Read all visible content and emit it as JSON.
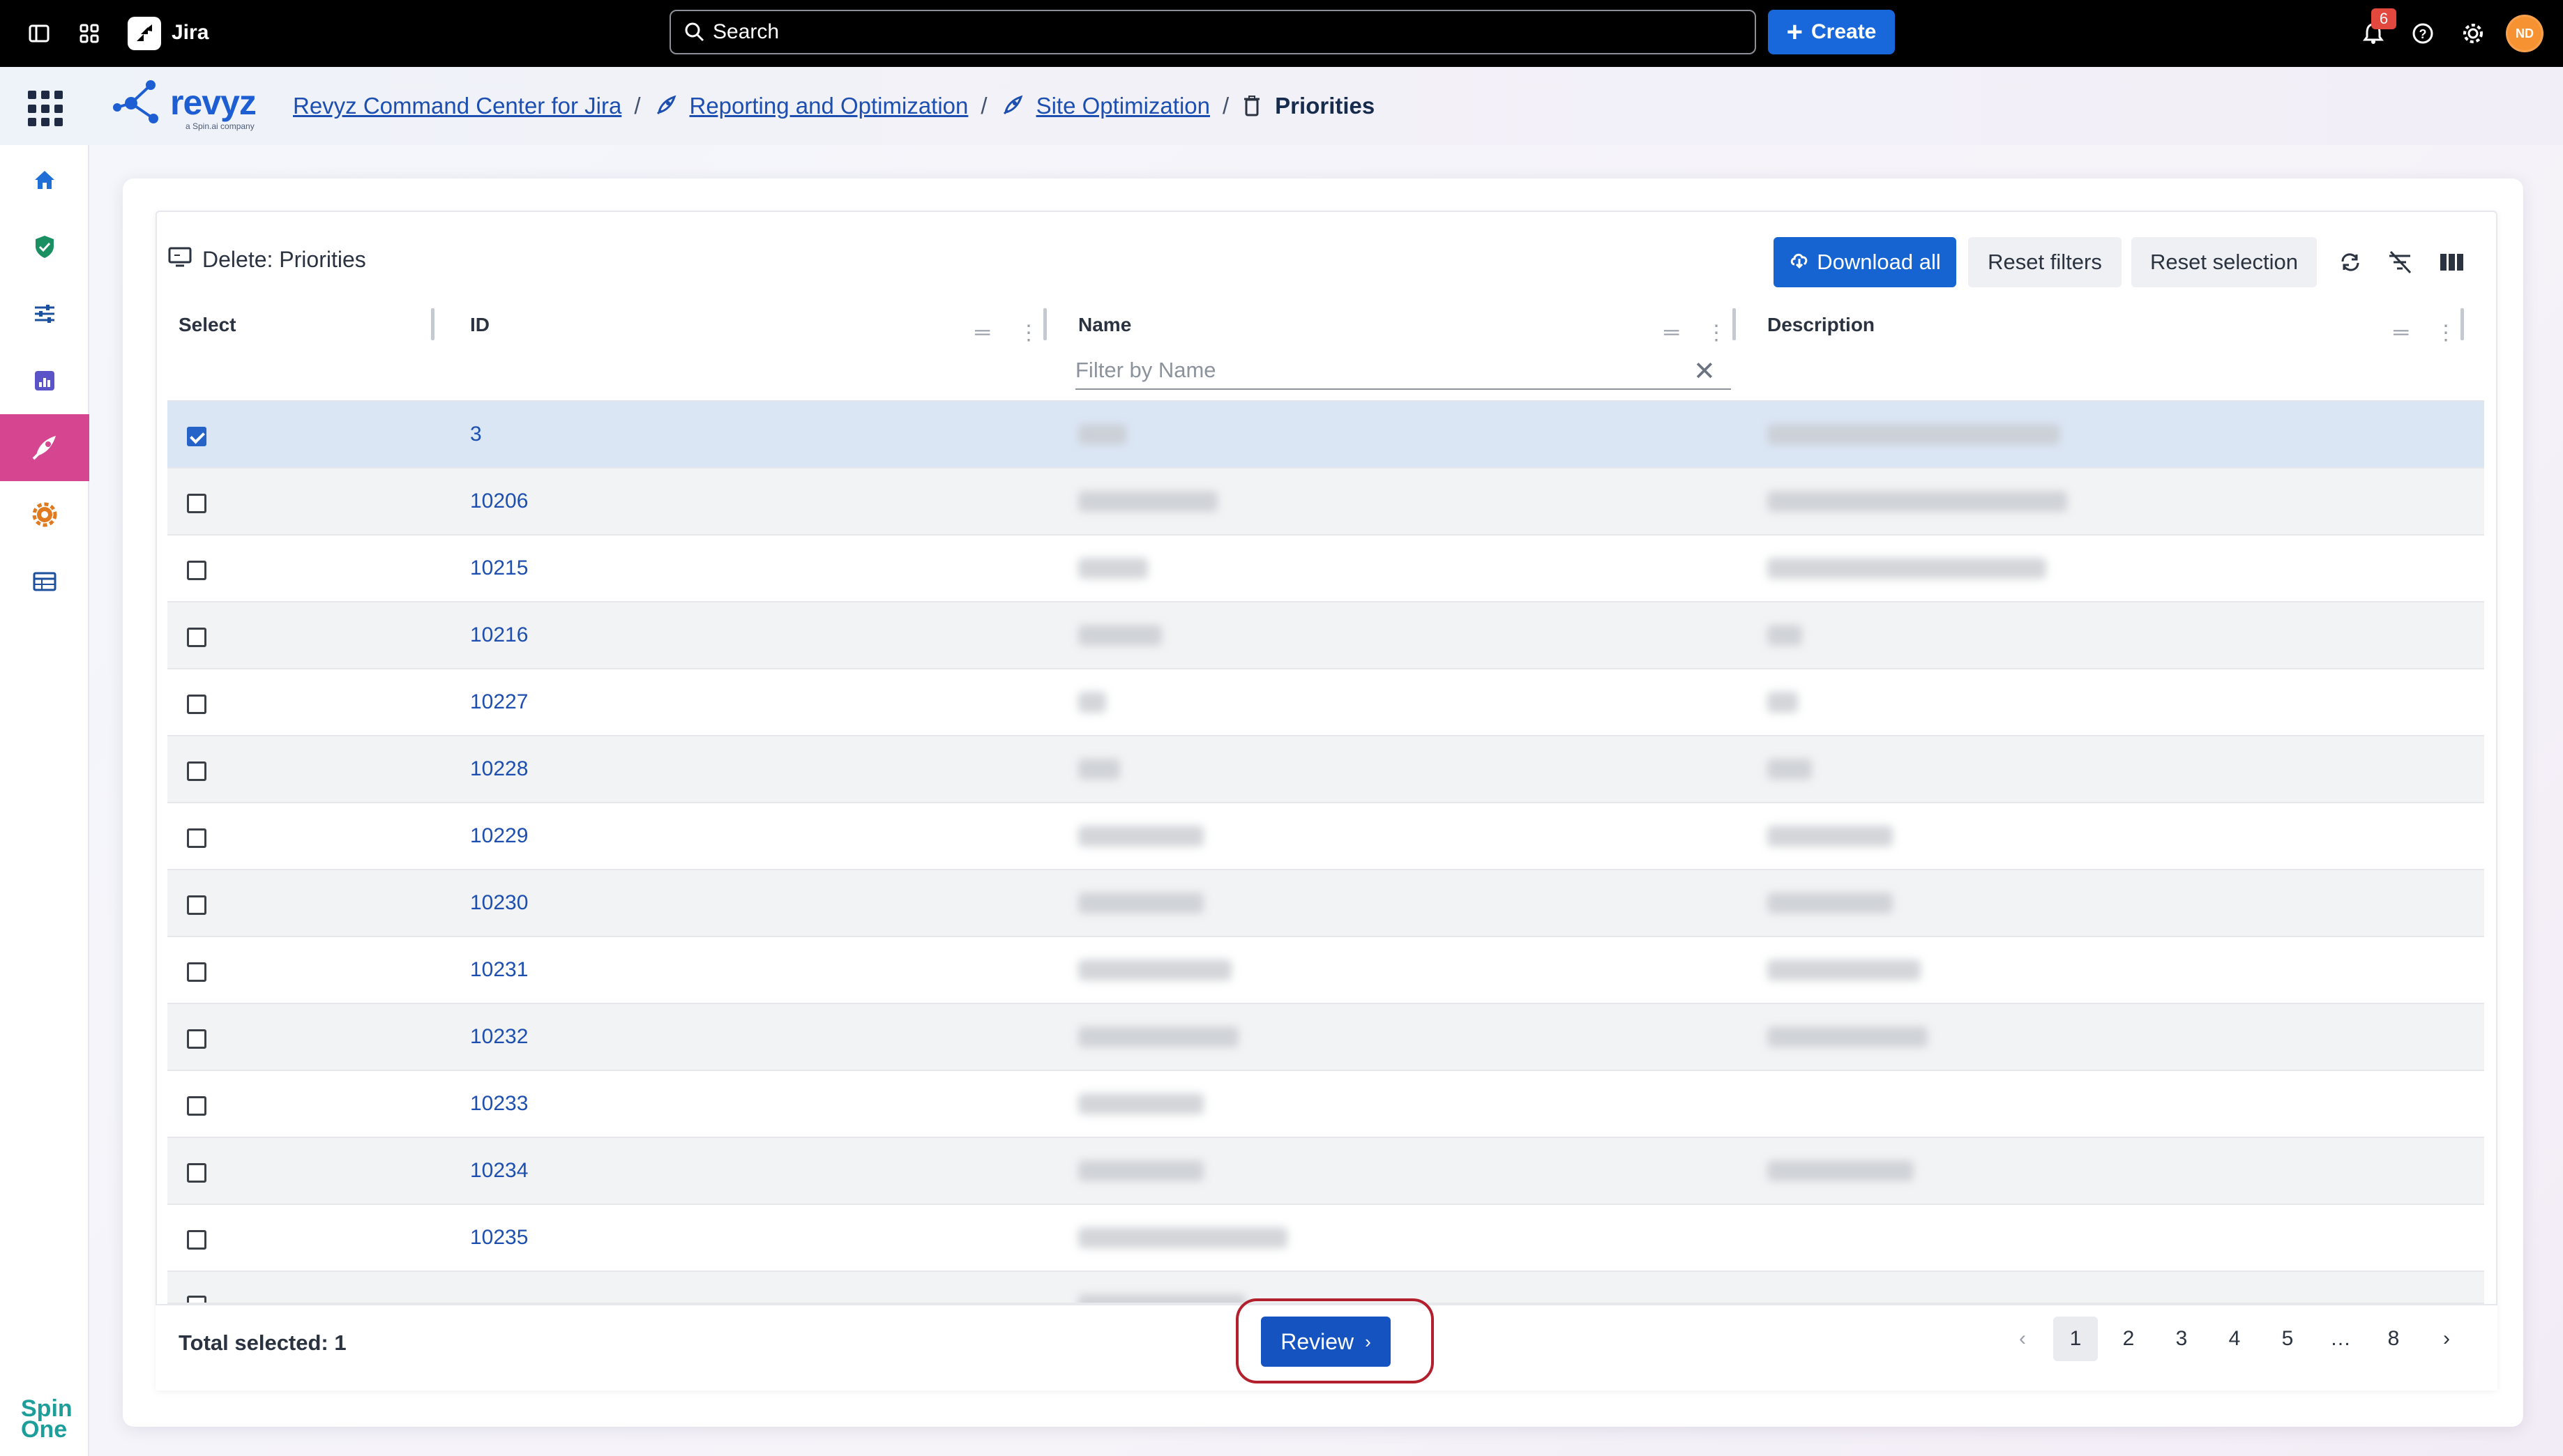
{
  "topbar": {
    "app_name": "Jira",
    "search_placeholder": "Search",
    "create_label": "Create",
    "notification_count": "6",
    "avatar_initials": "ND"
  },
  "header": {
    "logo_text": "revyz",
    "logo_sub": "a Spin.ai company",
    "breadcrumbs": [
      {
        "label": "Revyz Command Center for Jira"
      },
      {
        "label": "Reporting and Optimization"
      },
      {
        "label": "Site Optimization"
      },
      {
        "label": "Priorities"
      }
    ]
  },
  "sidebar": {
    "items": [
      {
        "icon": "home-icon"
      },
      {
        "icon": "shield-check-icon"
      },
      {
        "icon": "sliders-icon"
      },
      {
        "icon": "report-chart-icon"
      },
      {
        "icon": "rocket-icon",
        "active": true
      },
      {
        "icon": "gear-icon"
      },
      {
        "icon": "table-icon"
      }
    ],
    "brand": [
      "Spin",
      "One"
    ]
  },
  "panel": {
    "title": "Delete: Priorities",
    "download_all": "Download all",
    "reset_filters": "Reset filters",
    "reset_selection": "Reset selection"
  },
  "table": {
    "columns": [
      "Select",
      "ID",
      "Name",
      "Description"
    ],
    "name_filter_placeholder": "Filter by Name",
    "rows": [
      {
        "id": "3",
        "checked": true
      },
      {
        "id": "10206",
        "checked": false
      },
      {
        "id": "10215",
        "checked": false
      },
      {
        "id": "10216",
        "checked": false
      },
      {
        "id": "10227",
        "checked": false
      },
      {
        "id": "10228",
        "checked": false
      },
      {
        "id": "10229",
        "checked": false
      },
      {
        "id": "10230",
        "checked": false
      },
      {
        "id": "10231",
        "checked": false
      },
      {
        "id": "10232",
        "checked": false
      },
      {
        "id": "10233",
        "checked": false
      },
      {
        "id": "10234",
        "checked": false
      },
      {
        "id": "10235",
        "checked": false
      }
    ]
  },
  "footer": {
    "total_selected": "Total selected: 1",
    "review_label": "Review",
    "pages": [
      "1",
      "2",
      "3",
      "4",
      "5",
      "…",
      "8"
    ],
    "active_page": "1"
  },
  "colors": {
    "primary": "#1664d1",
    "active_nav": "#d6458f",
    "highlight_ring": "#b21f2d"
  }
}
